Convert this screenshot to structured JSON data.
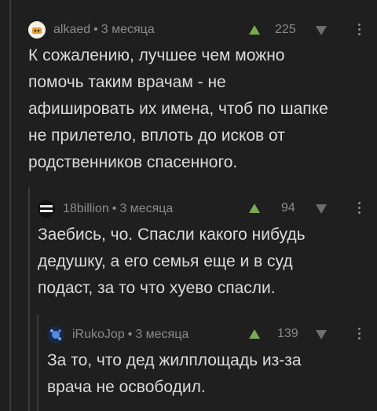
{
  "comments": [
    {
      "username": "alkaed",
      "time": "3 месяца",
      "rating": "225",
      "text": "К сожалению, лучшее чем можно\nпомочь таким врачам - не\nафишировать их имена, чтоб по шапке\nне прилетело, вплоть до исков от\nродственников спасенного."
    },
    {
      "username": "18billion",
      "time": "3 месяца",
      "rating": "94",
      "text": "Заебись, чо. Спасли какого нибудь\nдедушку, а его семья еще и в суд\nподаст, за то что хуево спасли."
    },
    {
      "username": "iRukoJop",
      "time": "3 месяца",
      "rating": "139",
      "text": "За то, что дед жилплощадь из-за\nврача не освободил."
    }
  ],
  "separator": "•",
  "colors": {
    "background": "#1f1f1f",
    "upvote": "#7aa94f",
    "meta": "#8a8a8a",
    "text": "#dadada"
  }
}
